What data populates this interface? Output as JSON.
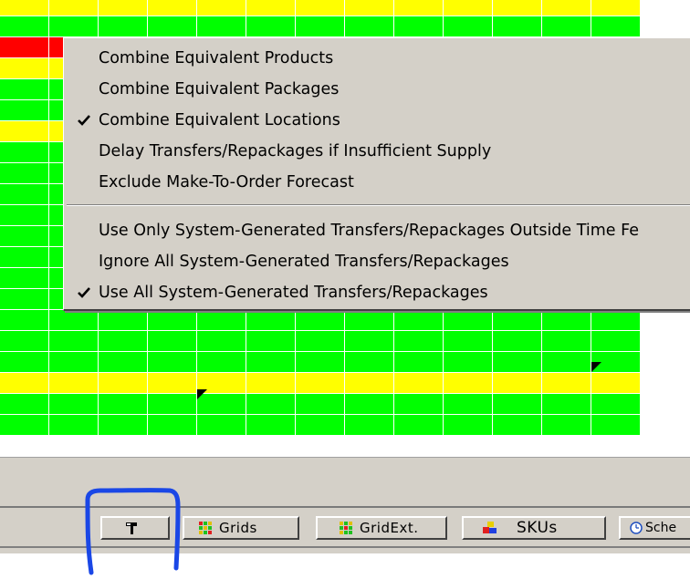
{
  "grid": {
    "colors": {
      "green": "#00ff00",
      "yellow": "#ffff00",
      "red": "#ff0000"
    },
    "rows": [
      "yellow",
      "green",
      "red",
      "yellow",
      "green",
      "green",
      "yellow",
      "green",
      "green",
      "green",
      "green",
      "green",
      "green",
      "green",
      "green",
      "green",
      "green",
      "green",
      "yellow",
      "green",
      "green"
    ],
    "columns": 13,
    "markers_icon": "triangle-marker-icon"
  },
  "context_menu": {
    "items": [
      {
        "label": "Combine Equivalent Products",
        "checked": false
      },
      {
        "label": "Combine Equivalent Packages",
        "checked": false
      },
      {
        "label": "Combine Equivalent Locations",
        "checked": true
      },
      {
        "label": "Delay Transfers/Repackages if Insufficient Supply",
        "checked": false
      },
      {
        "label": "Exclude Make-To-Order Forecast",
        "checked": false
      },
      {
        "label": "Use Only System-Generated Transfers/Repackages Outside Time Fe",
        "checked": false
      },
      {
        "label": "Ignore All System-Generated Transfers/Repackages",
        "checked": false
      },
      {
        "label": "Use All System-Generated Transfers/Repackages",
        "checked": true
      }
    ],
    "check_icon": "checkmark-icon"
  },
  "taskbar": {
    "buttons": [
      {
        "label": "",
        "icon": "hammer-icon"
      },
      {
        "label": "Grids",
        "icon": "grid-icon"
      },
      {
        "label": "GridExt.",
        "icon": "grid-icon"
      },
      {
        "label": "SKUs",
        "icon": "sku-blocks-icon"
      },
      {
        "label": "Sche",
        "icon": "clock-icon"
      }
    ]
  },
  "annotation": {
    "color": "#1a47e6",
    "shape": "hand-drawn-bracket-around-hammer-button"
  }
}
